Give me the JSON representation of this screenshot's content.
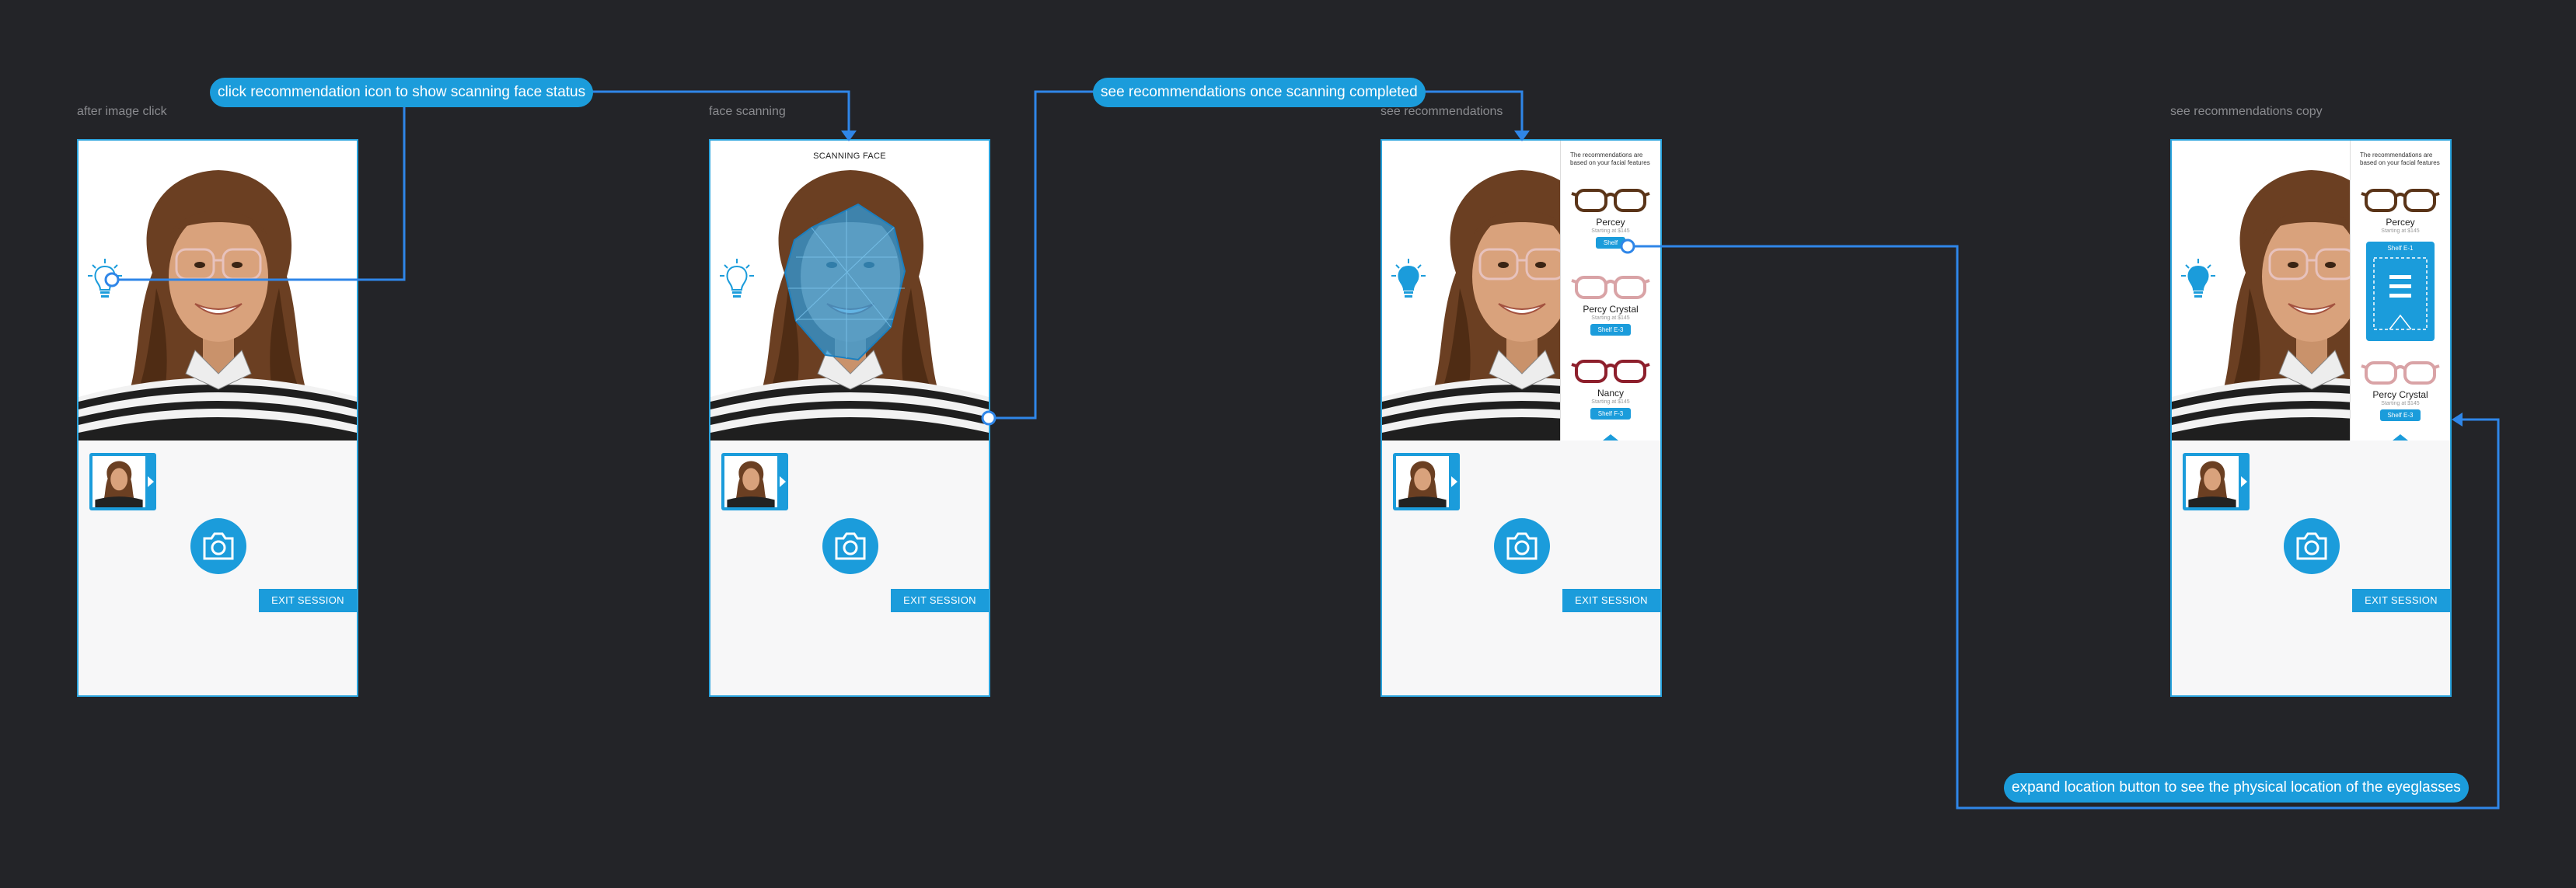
{
  "frames": [
    {
      "id": "after",
      "label": "after image click",
      "exit_label": "EXIT SESSION"
    },
    {
      "id": "scanning",
      "label": "face scanning",
      "scan_title": "SCANNING FACE",
      "exit_label": "EXIT SESSION"
    },
    {
      "id": "recs",
      "label": "see recommendations",
      "exit_label": "EXIT SESSION",
      "panel": {
        "intro": "The recommendations are based on your facial features",
        "items": [
          {
            "name": "Percey",
            "price": "Starting at $145",
            "shelf": "Shelf"
          },
          {
            "name": "Percy Crystal",
            "price": "Starting at $145",
            "shelf": "Shelf E-3"
          },
          {
            "name": "Nancy",
            "price": "Starting at $145",
            "shelf": "Shelf F-3"
          }
        ]
      }
    },
    {
      "id": "recs_copy",
      "label": "see recommendations copy",
      "exit_label": "EXIT SESSION",
      "panel": {
        "intro": "The recommendations are based on your facial features",
        "items": [
          {
            "name": "Percey",
            "price": "Starting at $145",
            "shelf": "Shelf E-1"
          },
          {
            "name": "Percy Crystal",
            "price": "Starting at $145",
            "shelf": "Shelf E-3"
          }
        ]
      }
    }
  ],
  "annotations": {
    "a1": "click recommendation icon to show scanning face status",
    "a2": "see recommendations once scanning completed",
    "a3": "expand location button to see the physical location of the eyeglasses"
  },
  "colors": {
    "accent": "#1b9cdb",
    "background": "#232428",
    "connector": "#2f86e8"
  }
}
